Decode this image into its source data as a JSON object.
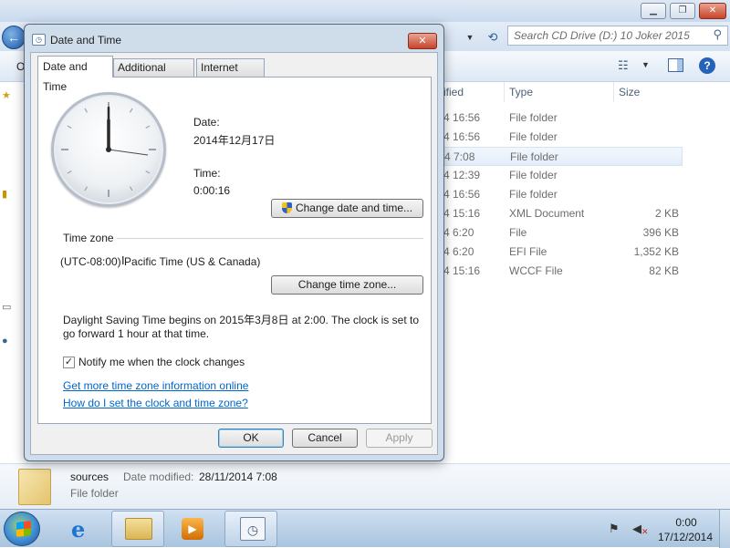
{
  "explorer": {
    "search_placeholder": "Search CD Drive (D:) 10 Joker 2015",
    "toolbar_org": "O",
    "columns": {
      "modified": "ified",
      "type": "Type",
      "size": "Size"
    },
    "rows": [
      {
        "modified": "4 16:56",
        "type": "File folder",
        "size": ""
      },
      {
        "modified": "4 16:56",
        "type": "File folder",
        "size": ""
      },
      {
        "modified": "4 7:08",
        "type": "File folder",
        "size": ""
      },
      {
        "modified": "4 12:39",
        "type": "File folder",
        "size": ""
      },
      {
        "modified": "4 16:56",
        "type": "File folder",
        "size": ""
      },
      {
        "modified": "4 15:16",
        "type": "XML Document",
        "size": "2 KB"
      },
      {
        "modified": "4 6:20",
        "type": "File",
        "size": "396 KB"
      },
      {
        "modified": "4 6:20",
        "type": "EFI File",
        "size": "1,352 KB"
      },
      {
        "modified": "4 15:16",
        "type": "WCCF File",
        "size": "82 KB"
      }
    ],
    "details": {
      "name": "sources",
      "modified_label": "Date modified:",
      "modified_value": "28/11/2014 7:08",
      "type": "File folder"
    }
  },
  "taskbar": {
    "clock_time": "0:00",
    "clock_date": "17/12/2014"
  },
  "dialog": {
    "title": "Date and Time",
    "close_label": "✕",
    "tabs": [
      "Date and Time",
      "Additional Clocks",
      "Internet Time"
    ],
    "date_label": "Date:",
    "date_value": "2014年12月17日",
    "time_label": "Time:",
    "time_value": "0:00:16",
    "change_datetime_button": "Change date and time...",
    "timezone_heading": "Time zone",
    "timezone_value": "(UTC-08:00) Pacific Time (US & Canada)",
    "change_timezone_button": "Change time zone...",
    "dst_text": "Daylight Saving Time begins on 2015年3月8日 at 2:00. The clock is set to go forward 1 hour at that time.",
    "notify_label": "Notify me when the clock changes",
    "notify_checked": "✓",
    "link_tz_online": "Get more time zone information online",
    "link_howto": "How do I set the clock and time zone?",
    "ok_button": "OK",
    "cancel_button": "Cancel",
    "apply_button": "Apply"
  }
}
